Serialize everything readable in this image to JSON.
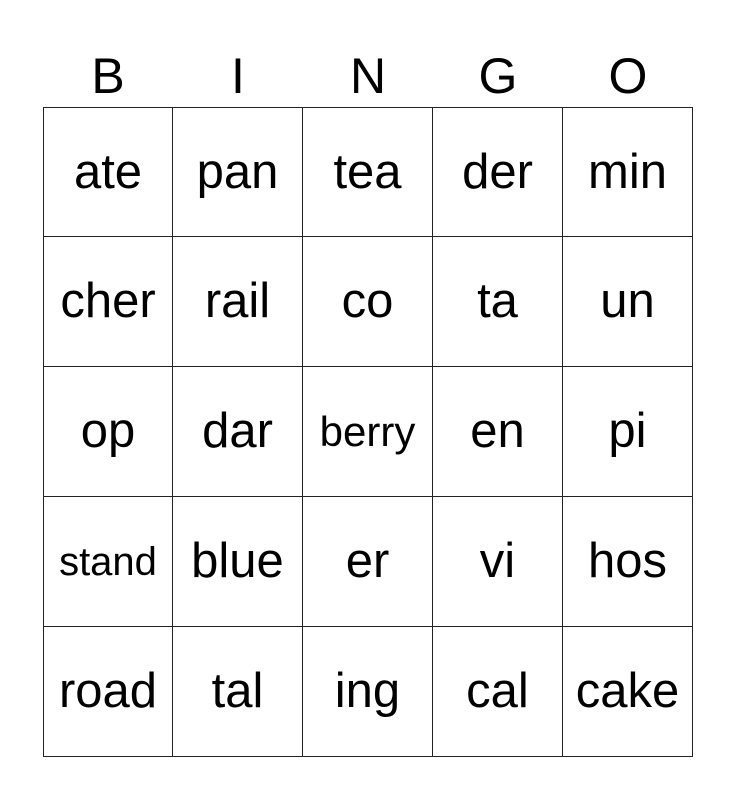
{
  "card": {
    "headers": [
      "B",
      "I",
      "N",
      "G",
      "O"
    ],
    "rows": [
      [
        "ate",
        "pan",
        "tea",
        "der",
        "min"
      ],
      [
        "cher",
        "rail",
        "co",
        "ta",
        "un"
      ],
      [
        "op",
        "dar",
        "berry",
        "en",
        "pi"
      ],
      [
        "stand",
        "blue",
        "er",
        "vi",
        "hos"
      ],
      [
        "road",
        "tal",
        "ing",
        "cal",
        "cake"
      ]
    ]
  }
}
